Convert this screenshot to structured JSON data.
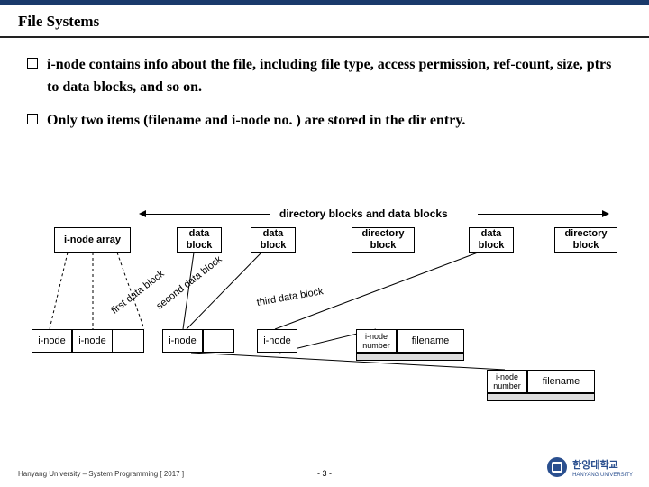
{
  "title": "File Systems",
  "bullets": [
    "i-node contains info about the file, including file type, access permission, ref-count, size, ptrs to data blocks, and so on.",
    "Only two items (filename and i-node no. ) are stored in the dir entry."
  ],
  "diagram": {
    "caption": "directory blocks and data blocks",
    "top_labels": {
      "inode_array": "i-node array",
      "data_block": "data\nblock",
      "directory_block": "directory\nblock"
    },
    "ptr_labels": {
      "first": "first data block",
      "second": "second data block",
      "third": "third data block"
    },
    "row_labels": {
      "inode": "i-node",
      "inode_number": "i-node\nnumber",
      "filename": "filename"
    }
  },
  "footer": "Hanyang University – System Programming [ 2017 ]",
  "page": "- 3 -",
  "university": "한양대학교",
  "university_en": "HANYANG UNIVERSITY"
}
